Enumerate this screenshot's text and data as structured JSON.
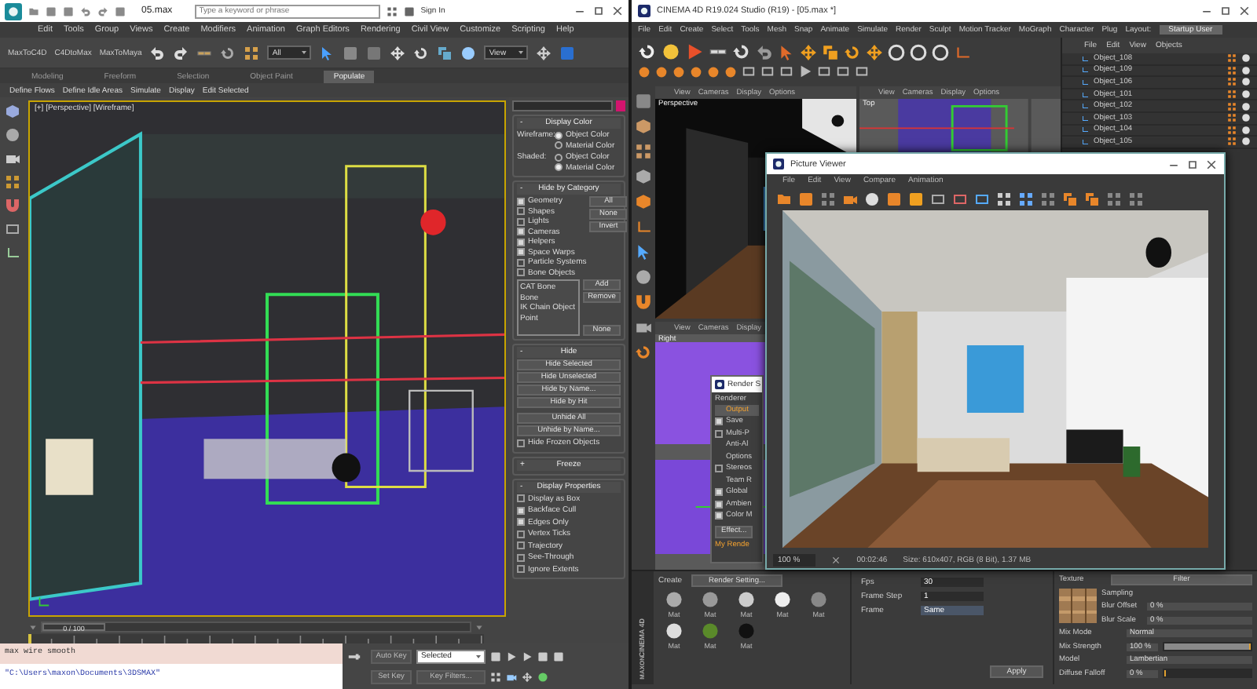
{
  "max_window": {
    "title": "05.max",
    "search": {
      "placeholder": "Type a keyword or phrase"
    },
    "sign_in": "Sign In",
    "menu": [
      "Edit",
      "Tools",
      "Group",
      "Views",
      "Create",
      "Modifiers",
      "Animation",
      "Graph Editors",
      "Rendering",
      "Civil View",
      "Customize",
      "Scripting",
      "Help"
    ],
    "toolbar": {
      "plugins": [
        "MaxToC4D",
        "C4DtoMax",
        "MaxToMaya"
      ],
      "selection_filter": "All",
      "reference_coordinates": "View"
    },
    "ribbon_tabs": [
      {
        "label": "Modeling",
        "selected": false
      },
      {
        "label": "Freeform",
        "selected": false
      },
      {
        "label": "Selection",
        "selected": false
      },
      {
        "label": "Object Paint",
        "selected": false
      },
      {
        "label": "Populate",
        "selected": true
      }
    ],
    "ribbon_commands": [
      "Define Flows",
      "Define Idle Areas",
      "Simulate",
      "Display",
      "Edit Selected"
    ],
    "viewport": {
      "label": "[+] [Perspective] [Wireframe]"
    },
    "command_panel": {
      "display_color": {
        "sign": "-",
        "title": "Display Color",
        "groups": [
          {
            "label": "Wireframe:",
            "options": [
              {
                "label": "Object Color",
                "selected": true
              },
              {
                "label": "Material Color",
                "selected": false
              }
            ]
          },
          {
            "label": "Shaded:",
            "options": [
              {
                "label": "Object Color",
                "selected": false
              },
              {
                "label": "Material Color",
                "selected": true
              }
            ]
          }
        ]
      },
      "hide_by_category": {
        "sign": "-",
        "title": "Hide by Category",
        "items": [
          {
            "label": "Geometry",
            "checked": true
          },
          {
            "label": "Shapes",
            "checked": false
          },
          {
            "label": "Lights",
            "checked": false
          },
          {
            "label": "Cameras",
            "checked": true
          },
          {
            "label": "Helpers",
            "checked": true
          },
          {
            "label": "Space Warps",
            "checked": true
          },
          {
            "label": "Particle Systems",
            "checked": false
          },
          {
            "label": "Bone Objects",
            "checked": false
          }
        ],
        "buttons": [
          "All",
          "None",
          "Invert"
        ],
        "list": [
          "CAT Bone",
          "Bone",
          "IK Chain Object",
          "Point"
        ],
        "list_buttons": [
          "Add",
          "Remove",
          "None"
        ]
      },
      "hide": {
        "sign": "-",
        "title": "Hide",
        "buttons": [
          "Hide Selected",
          "Hide Unselected",
          "Hide by Name...",
          "Hide by Hit"
        ],
        "unhide_buttons": [
          "Unhide All",
          "Unhide by Name..."
        ],
        "frozen": {
          "label": "Hide Frozen Objects",
          "checked": false
        }
      },
      "freeze": {
        "sign": "+",
        "title": "Freeze"
      },
      "display_properties": {
        "sign": "-",
        "title": "Display Properties",
        "items": [
          {
            "label": "Display as Box",
            "checked": false
          },
          {
            "label": "Backface Cull",
            "checked": true
          },
          {
            "label": "Edges Only",
            "checked": true
          },
          {
            "label": "Vertex Ticks",
            "checked": false
          },
          {
            "label": "Trajectory",
            "checked": false
          },
          {
            "label": "See-Through",
            "checked": false
          },
          {
            "label": "Ignore Extents",
            "checked": false
          }
        ]
      }
    },
    "time_slider": {
      "frame": "0 / 100",
      "level": 0
    },
    "listener": {
      "input": "max wire smooth",
      "output": "\"C:\\Users\\maxon\\Documents\\3DSMAX\""
    },
    "animation": {
      "auto_key": "Auto Key",
      "key_mode": "Selected",
      "set_key": "Set Key",
      "key_filters": "Key Filters..."
    }
  },
  "c4d_window": {
    "title": "CINEMA 4D R19.024 Studio (R19) - [05.max *]",
    "menu": [
      "File",
      "Edit",
      "Create",
      "Select",
      "Tools",
      "Mesh",
      "Snap",
      "Animate",
      "Simulate",
      "Render",
      "Sculpt",
      "Motion Tracker",
      "MoGraph",
      "Character",
      "Plug"
    ],
    "layout": {
      "label": "Layout:",
      "value": "Startup User"
    },
    "viewports": [
      {
        "name": "Perspective",
        "menu": [
          "View",
          "Cameras",
          "Display",
          "Options"
        ]
      },
      {
        "name": "Top",
        "menu": [
          "View",
          "Cameras",
          "Display",
          "Options"
        ]
      },
      {
        "name": "Right",
        "menu": [
          "View",
          "Cameras",
          "Display"
        ]
      }
    ],
    "object_manager": {
      "menu": [
        "File",
        "Edit",
        "View",
        "Objects"
      ],
      "objects": [
        "Object_108",
        "Object_109",
        "Object_106",
        "Object_101",
        "Object_102",
        "Object_103",
        "Object_104",
        "Object_105"
      ]
    },
    "render_settings": {
      "title": "Render S",
      "renderer": "Renderer",
      "pages": [
        {
          "label": "Output",
          "kind": "page",
          "selected": true
        },
        {
          "label": "Save",
          "kind": "toggle",
          "checked": true,
          "selected": false
        },
        {
          "label": "Multi-P",
          "kind": "toggle",
          "checked": false,
          "selected": false
        },
        {
          "label": "Anti-Al",
          "kind": "page",
          "selected": false
        },
        {
          "label": "Options",
          "kind": "page",
          "selected": false
        },
        {
          "label": "Stereos",
          "kind": "toggle",
          "checked": false,
          "selected": false
        },
        {
          "label": "Team R",
          "kind": "page",
          "selected": false
        },
        {
          "label": "Global",
          "kind": "toggle",
          "checked": true,
          "selected": false
        },
        {
          "label": "Ambien",
          "kind": "toggle",
          "checked": true,
          "selected": false
        },
        {
          "label": "Color M",
          "kind": "toggle",
          "checked": true,
          "selected": false
        }
      ],
      "effect": "Effect...",
      "preset": "My Rende"
    },
    "picture_viewer": {
      "title": "Picture Viewer",
      "menu": [
        "File",
        "Edit",
        "View",
        "Compare",
        "Animation"
      ],
      "zoom": "100 %",
      "time": "00:02:46",
      "info": "Size: 610x407, RGB (8 Bit), 1.37 MB"
    },
    "material_manager": {
      "menu": [
        "Create"
      ],
      "render_setting": "Render Setting...",
      "materials": [
        "Mat",
        "Mat",
        "Mat",
        "Mat",
        "Mat",
        "Mat",
        "Mat",
        "Mat"
      ]
    },
    "render_params": [
      {
        "label": "Fps",
        "value": "30"
      },
      {
        "label": "Frame Step",
        "value": "1"
      },
      {
        "label": "Frame",
        "value": "Same"
      }
    ],
    "apply": "Apply",
    "attributes": {
      "texture": "Texture",
      "filter": "Filter",
      "sampling": "Sampling",
      "blur_offset": {
        "label": "Blur Offset",
        "value": "0 %"
      },
      "blur_scale": {
        "label": "Blur Scale",
        "value": "0 %"
      },
      "mix_mode": {
        "label": "Mix Mode",
        "value": "Normal"
      },
      "mix_strength": {
        "label": "Mix Strength",
        "value": "100 %",
        "level": 1
      },
      "model": {
        "label": "Model",
        "value": "Lambertian"
      },
      "diffuse_falloff": {
        "label": "Diffuse Falloff",
        "value": "0 %",
        "level": 0
      }
    },
    "logo": [
      "MAXON",
      "CINEMA 4D"
    ]
  }
}
